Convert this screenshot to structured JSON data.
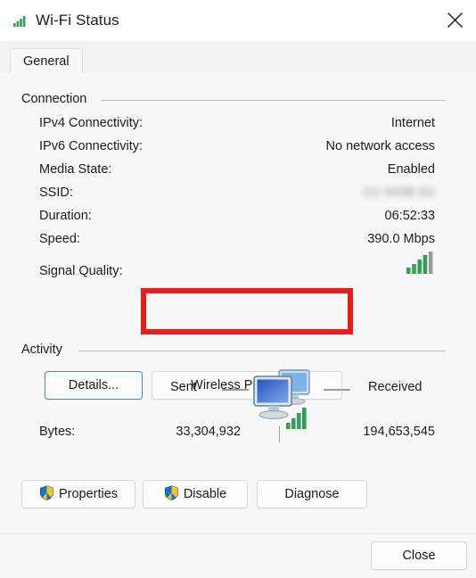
{
  "window": {
    "title": "Wi-Fi Status",
    "title_icon": "wifi-signal-icon",
    "close_icon": "close-icon"
  },
  "tabs": [
    {
      "label": "General",
      "selected": true
    }
  ],
  "connection": {
    "legend": "Connection",
    "rows": [
      {
        "label": "IPv4 Connectivity:",
        "value": "Internet",
        "blurred": false
      },
      {
        "label": "IPv6 Connectivity:",
        "value": "No network access",
        "blurred": false
      },
      {
        "label": "Media State:",
        "value": "Enabled",
        "blurred": false
      },
      {
        "label": "SSID:",
        "value": "CC-9438 5G",
        "blurred": true
      },
      {
        "label": "Duration:",
        "value": "06:52:33",
        "blurred": false
      },
      {
        "label": "Speed:",
        "value": "390.0 Mbps",
        "blurred": false
      }
    ],
    "signal_quality": {
      "label": "Signal Quality:",
      "icon": "signal-bars-icon",
      "bars_total": 5,
      "bars_filled": 4
    },
    "buttons": {
      "details": "Details...",
      "wireless_properties": "Wireless Properties"
    }
  },
  "annotation": {
    "color": "#ee1b1b",
    "target": "wireless-properties-button"
  },
  "activity": {
    "legend": "Activity",
    "sent_label": "Sent",
    "received_label": "Received",
    "center_icon": "network-monitors-icon",
    "bytes_label": "Bytes:",
    "bytes_sent": "33,304,932",
    "bytes_received": "194,653,545"
  },
  "actions": {
    "properties": "Properties",
    "disable": "Disable",
    "diagnose": "Diagnose",
    "shield_icon": "uac-shield-icon"
  },
  "footer": {
    "close": "Close"
  },
  "colors": {
    "accent_blue": "#4a87b5",
    "annotation_red": "#ee1b1b",
    "signal_green": "#2f9e4f",
    "shield_blue": "#1c6fd0",
    "shield_yellow": "#f5c518",
    "window_bg": "#f8f8f8"
  }
}
